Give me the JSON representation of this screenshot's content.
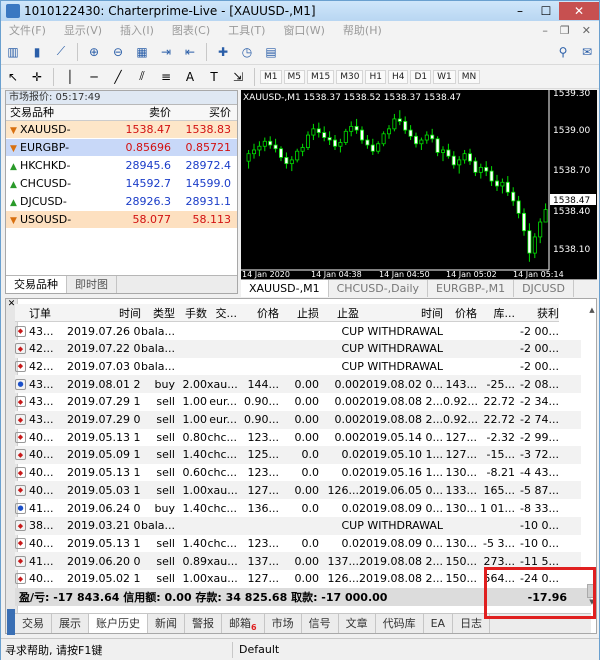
{
  "window": {
    "title": "1010122430: Charterprime-Live - [XAUUSD-,M1]",
    "minimize": "–",
    "maximize": "☐",
    "close": "✕"
  },
  "menu": [
    "文件(F)",
    "显示(V)",
    "插入(I)",
    "图表(C)",
    "工具(T)",
    "窗口(W)",
    "帮助(H)"
  ],
  "mdi_controls": [
    "–",
    "❐",
    "✕"
  ],
  "timeframes": [
    "M1",
    "M5",
    "M15",
    "M30",
    "H1",
    "H4",
    "D1",
    "W1",
    "MN"
  ],
  "market_watch": {
    "header": "市场报价: 05:17:49",
    "col_symbol": "交易品种",
    "col_bid": "卖价",
    "col_ask": "买价",
    "rows": [
      {
        "symbol": "XAUUSD-",
        "bid": "1538.47",
        "ask": "1538.83",
        "dir": "down",
        "bg": "#fde6c8"
      },
      {
        "symbol": "EURGBP-",
        "bid": "0.85696",
        "ask": "0.85721",
        "dir": "down",
        "bg": "#c8d8f8"
      },
      {
        "symbol": "HKCHKD-",
        "bid": "28945.6",
        "ask": "28972.4",
        "dir": "up",
        "bg": "#ffffff"
      },
      {
        "symbol": "CHCUSD-",
        "bid": "14592.7",
        "ask": "14599.0",
        "dir": "up",
        "bg": "#ffffff"
      },
      {
        "symbol": "DJCUSD-",
        "bid": "28926.3",
        "ask": "28931.1",
        "dir": "up",
        "bg": "#ffffff"
      },
      {
        "symbol": "USOUSD-",
        "bid": "58.077",
        "ask": "58.113",
        "dir": "down",
        "bg": "#fde0c0"
      }
    ],
    "tab_symbols": "交易品种",
    "tab_tick": "即时图"
  },
  "chart": {
    "header": "XAUUSD-,M1  1538.37 1538.52 1538.37 1538.47",
    "price_labels": [
      "1539.30",
      "1539.00",
      "1538.70",
      "1538.47",
      "1538.40",
      "1538.10"
    ],
    "time_labels": [
      "14 Jan 2020",
      "14 Jan 04:38",
      "14 Jan 04:50",
      "14 Jan 05:02",
      "14 Jan 05:14"
    ],
    "tabs": [
      "XAUUSD-,M1",
      "CHCUSD-,Daily",
      "EURGBP-,M1",
      "DJCUSD"
    ]
  },
  "terminal": {
    "headers": [
      "订单",
      "时间",
      "类型",
      "手数",
      "交...",
      "价格",
      "止损",
      "止盈",
      "时间",
      "价格",
      "库...",
      "获利"
    ],
    "rows": [
      {
        "icon": "red",
        "c": [
          "43...",
          "2019.07.26 0...",
          "bala...",
          "",
          "",
          "",
          "",
          "",
          "CUP WITHDRAWAL",
          "",
          "",
          "-2 00..."
        ]
      },
      {
        "icon": "red",
        "c": [
          "42...",
          "2019.07.22 0...",
          "bala...",
          "",
          "",
          "",
          "",
          "",
          "CUP WITHDRAWAL",
          "",
          "",
          "-2 00..."
        ]
      },
      {
        "icon": "red",
        "c": [
          "42...",
          "2019.07.03 0...",
          "bala...",
          "",
          "",
          "",
          "",
          "",
          "CUP WITHDRAWAL",
          "",
          "",
          "-2 00..."
        ]
      },
      {
        "icon": "blue",
        "c": [
          "43...",
          "2019.08.01 2...",
          "buy",
          "2.00",
          "xau...",
          "144...",
          "0.00",
          "0.00",
          "2019.08.02 0...",
          "143...",
          "-25...",
          "-2 08..."
        ]
      },
      {
        "icon": "red",
        "c": [
          "43...",
          "2019.07.29 1...",
          "sell",
          "1.00",
          "eur...",
          "0.90...",
          "0.00",
          "0.00",
          "2019.08.08 2...",
          "0.92...",
          "22.72",
          "-2 34..."
        ]
      },
      {
        "icon": "red",
        "c": [
          "43...",
          "2019.07.29 0...",
          "sell",
          "1.00",
          "eur...",
          "0.90...",
          "0.00",
          "0.00",
          "2019.08.08 2...",
          "0.92...",
          "22.72",
          "-2 74..."
        ]
      },
      {
        "icon": "red",
        "c": [
          "40...",
          "2019.05.13 1...",
          "sell",
          "0.80",
          "chc...",
          "123...",
          "0.00",
          "0.00",
          "2019.05.14 0...",
          "127...",
          "-2.32",
          "-2 99..."
        ]
      },
      {
        "icon": "red",
        "c": [
          "40...",
          "2019.05.09 1...",
          "sell",
          "1.40",
          "chc...",
          "125...",
          "0.0",
          "0.0",
          "2019.05.10 1...",
          "127...",
          "-15...",
          "-3 72..."
        ]
      },
      {
        "icon": "red",
        "c": [
          "40...",
          "2019.05.13 1...",
          "sell",
          "0.60",
          "chc...",
          "123...",
          "0.0",
          "0.0",
          "2019.05.16 1...",
          "130...",
          "-8.21",
          "-4 43..."
        ]
      },
      {
        "icon": "red",
        "c": [
          "40...",
          "2019.05.03 1...",
          "sell",
          "1.00",
          "xau...",
          "127...",
          "0.00",
          "126...",
          "2019.06.05 0...",
          "133...",
          "165...",
          "-5 87..."
        ]
      },
      {
        "icon": "blue",
        "c": [
          "41...",
          "2019.06.24 0...",
          "buy",
          "1.40",
          "chc...",
          "136...",
          "0.0",
          "0.0",
          "2019.08.09 0...",
          "130...",
          "1 01...",
          "-8 33..."
        ]
      },
      {
        "icon": "red",
        "c": [
          "38...",
          "2019.03.21 0...",
          "bala...",
          "",
          "",
          "",
          "",
          "",
          "CUP WITHDRAWAL",
          "",
          "",
          "-10 0..."
        ]
      },
      {
        "icon": "red",
        "c": [
          "40...",
          "2019.05.13 1...",
          "sell",
          "1.40",
          "chc...",
          "123...",
          "0.0",
          "0.0",
          "2019.08.09 0...",
          "130...",
          "-5 3...",
          "-10 0..."
        ]
      },
      {
        "icon": "red",
        "c": [
          "41...",
          "2019.06.20 0...",
          "sell",
          "0.89",
          "xau...",
          "137...",
          "0.00",
          "137...",
          "2019.08.08 2...",
          "150...",
          "273...",
          "-11 5..."
        ]
      },
      {
        "icon": "red",
        "c": [
          "40...",
          "2019.05.02 1...",
          "sell",
          "1.00",
          "xau...",
          "127...",
          "0.00",
          "126...",
          "2019.08.08 2...",
          "150...",
          "564...",
          "-24 0..."
        ]
      }
    ],
    "summary": "盈/亏: -17 843.64  信用额: 0.00  存款: 34 825.68  取款: -17 000.00",
    "summary_total": "-17.96",
    "tabs": [
      "交易",
      "展示",
      "账户历史",
      "新闻",
      "警报",
      "邮箱",
      "市场",
      "信号",
      "文章",
      "代码库",
      "EA",
      "日志"
    ],
    "active_tab": "账户历史",
    "mail_badge": "6"
  },
  "status": {
    "help": "寻求帮助, 请按F1键",
    "profile": "Default"
  }
}
